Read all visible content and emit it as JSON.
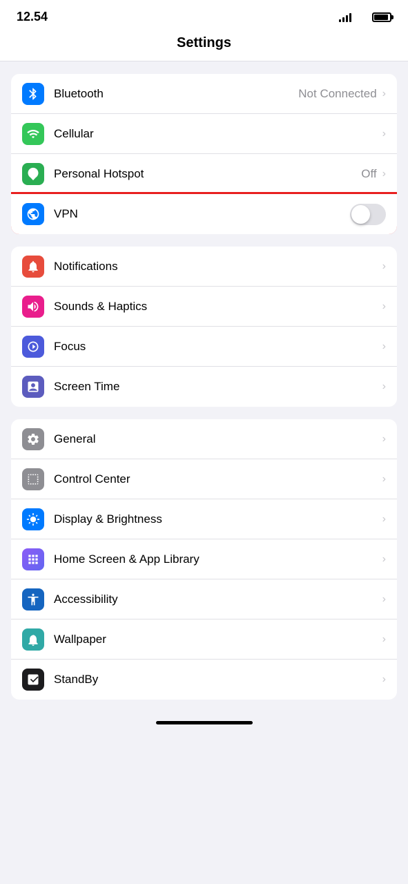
{
  "statusBar": {
    "time": "12.54",
    "signal": "signal-icon",
    "wifi": "wifi-icon",
    "battery": "battery-icon"
  },
  "pageTitle": "Settings",
  "groups": [
    {
      "id": "connectivity",
      "highlighted": false,
      "items": [
        {
          "id": "bluetooth",
          "label": "Bluetooth",
          "value": "Not Connected",
          "hasChevron": true,
          "hasToggle": false,
          "iconColor": "blue",
          "iconType": "bluetooth"
        },
        {
          "id": "cellular",
          "label": "Cellular",
          "value": "",
          "hasChevron": true,
          "hasToggle": false,
          "iconColor": "green",
          "iconType": "cellular"
        },
        {
          "id": "hotspot",
          "label": "Personal Hotspot",
          "value": "Off",
          "hasChevron": true,
          "hasToggle": false,
          "iconColor": "green2",
          "iconType": "hotspot"
        },
        {
          "id": "vpn",
          "label": "VPN",
          "value": "",
          "hasChevron": false,
          "hasToggle": true,
          "toggleOn": false,
          "iconColor": "blue",
          "iconType": "vpn",
          "highlighted": true
        }
      ]
    },
    {
      "id": "notifications-group",
      "highlighted": false,
      "items": [
        {
          "id": "notifications",
          "label": "Notifications",
          "value": "",
          "hasChevron": true,
          "hasToggle": false,
          "iconColor": "red",
          "iconType": "notifications"
        },
        {
          "id": "sounds",
          "label": "Sounds & Haptics",
          "value": "",
          "hasChevron": true,
          "hasToggle": false,
          "iconColor": "pink",
          "iconType": "sounds"
        },
        {
          "id": "focus",
          "label": "Focus",
          "value": "",
          "hasChevron": true,
          "hasToggle": false,
          "iconColor": "indigo",
          "iconType": "focus"
        },
        {
          "id": "screentime",
          "label": "Screen Time",
          "value": "",
          "hasChevron": true,
          "hasToggle": false,
          "iconColor": "purple",
          "iconType": "screentime"
        }
      ]
    },
    {
      "id": "display-group",
      "highlighted": false,
      "items": [
        {
          "id": "general",
          "label": "General",
          "value": "",
          "hasChevron": true,
          "hasToggle": false,
          "iconColor": "gray",
          "iconType": "general"
        },
        {
          "id": "controlcenter",
          "label": "Control Center",
          "value": "",
          "hasChevron": true,
          "hasToggle": false,
          "iconColor": "gray",
          "iconType": "controlcenter"
        },
        {
          "id": "display",
          "label": "Display & Brightness",
          "value": "",
          "hasChevron": true,
          "hasToggle": false,
          "iconColor": "blue",
          "iconType": "display"
        },
        {
          "id": "homescreen",
          "label": "Home Screen & App Library",
          "value": "",
          "hasChevron": true,
          "hasToggle": false,
          "iconColor": "indigo",
          "iconType": "homescreen"
        },
        {
          "id": "accessibility",
          "label": "Accessibility",
          "value": "",
          "hasChevron": true,
          "hasToggle": false,
          "iconColor": "darkblue",
          "iconType": "accessibility"
        },
        {
          "id": "wallpaper",
          "label": "Wallpaper",
          "value": "",
          "hasChevron": true,
          "hasToggle": false,
          "iconColor": "teal",
          "iconType": "wallpaper"
        },
        {
          "id": "standby",
          "label": "StandBy",
          "value": "",
          "hasChevron": true,
          "hasToggle": false,
          "iconColor": "standby",
          "iconType": "standby"
        }
      ]
    }
  ]
}
